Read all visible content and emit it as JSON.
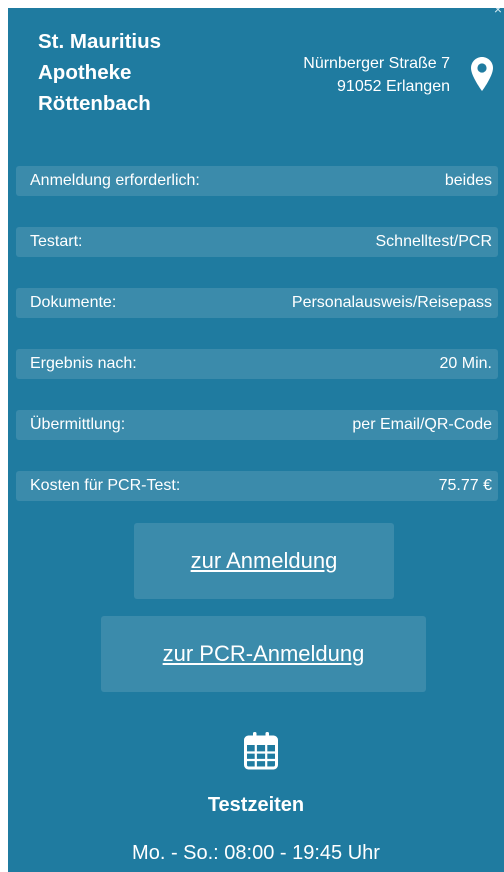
{
  "close_label": "×",
  "pharmacy": {
    "name_line1": "St. Mauritius",
    "name_line2": "Apotheke",
    "name_line3": "Röttenbach",
    "street": "Nürnberger Straße 7",
    "city": "91052 Erlangen"
  },
  "details": [
    {
      "label": "Anmeldung erforderlich:",
      "value": "beides"
    },
    {
      "label": "Testart:",
      "value": "Schnelltest/PCR"
    },
    {
      "label": "Dokumente:",
      "value": "Personalausweis/Reisepass"
    },
    {
      "label": "Ergebnis nach:",
      "value": "20 Min."
    },
    {
      "label": "Übermittlung:",
      "value": "per Email/QR-Code"
    },
    {
      "label": "Kosten für PCR-Test:",
      "value": "75.77 €"
    }
  ],
  "buttons": {
    "register": "zur Anmeldung",
    "pcr_register": "zur PCR-Anmeldung"
  },
  "testzeiten": {
    "title": "Testzeiten",
    "hours": "Mo. - So.: 08:00 - 19:45 Uhr"
  },
  "icons": {
    "location": "map-pin-icon",
    "calendar": "calendar-icon",
    "close": "close-icon"
  },
  "colors": {
    "panel": "#1f7ba0",
    "row": "#3b8bab",
    "text": "#ffffff"
  }
}
